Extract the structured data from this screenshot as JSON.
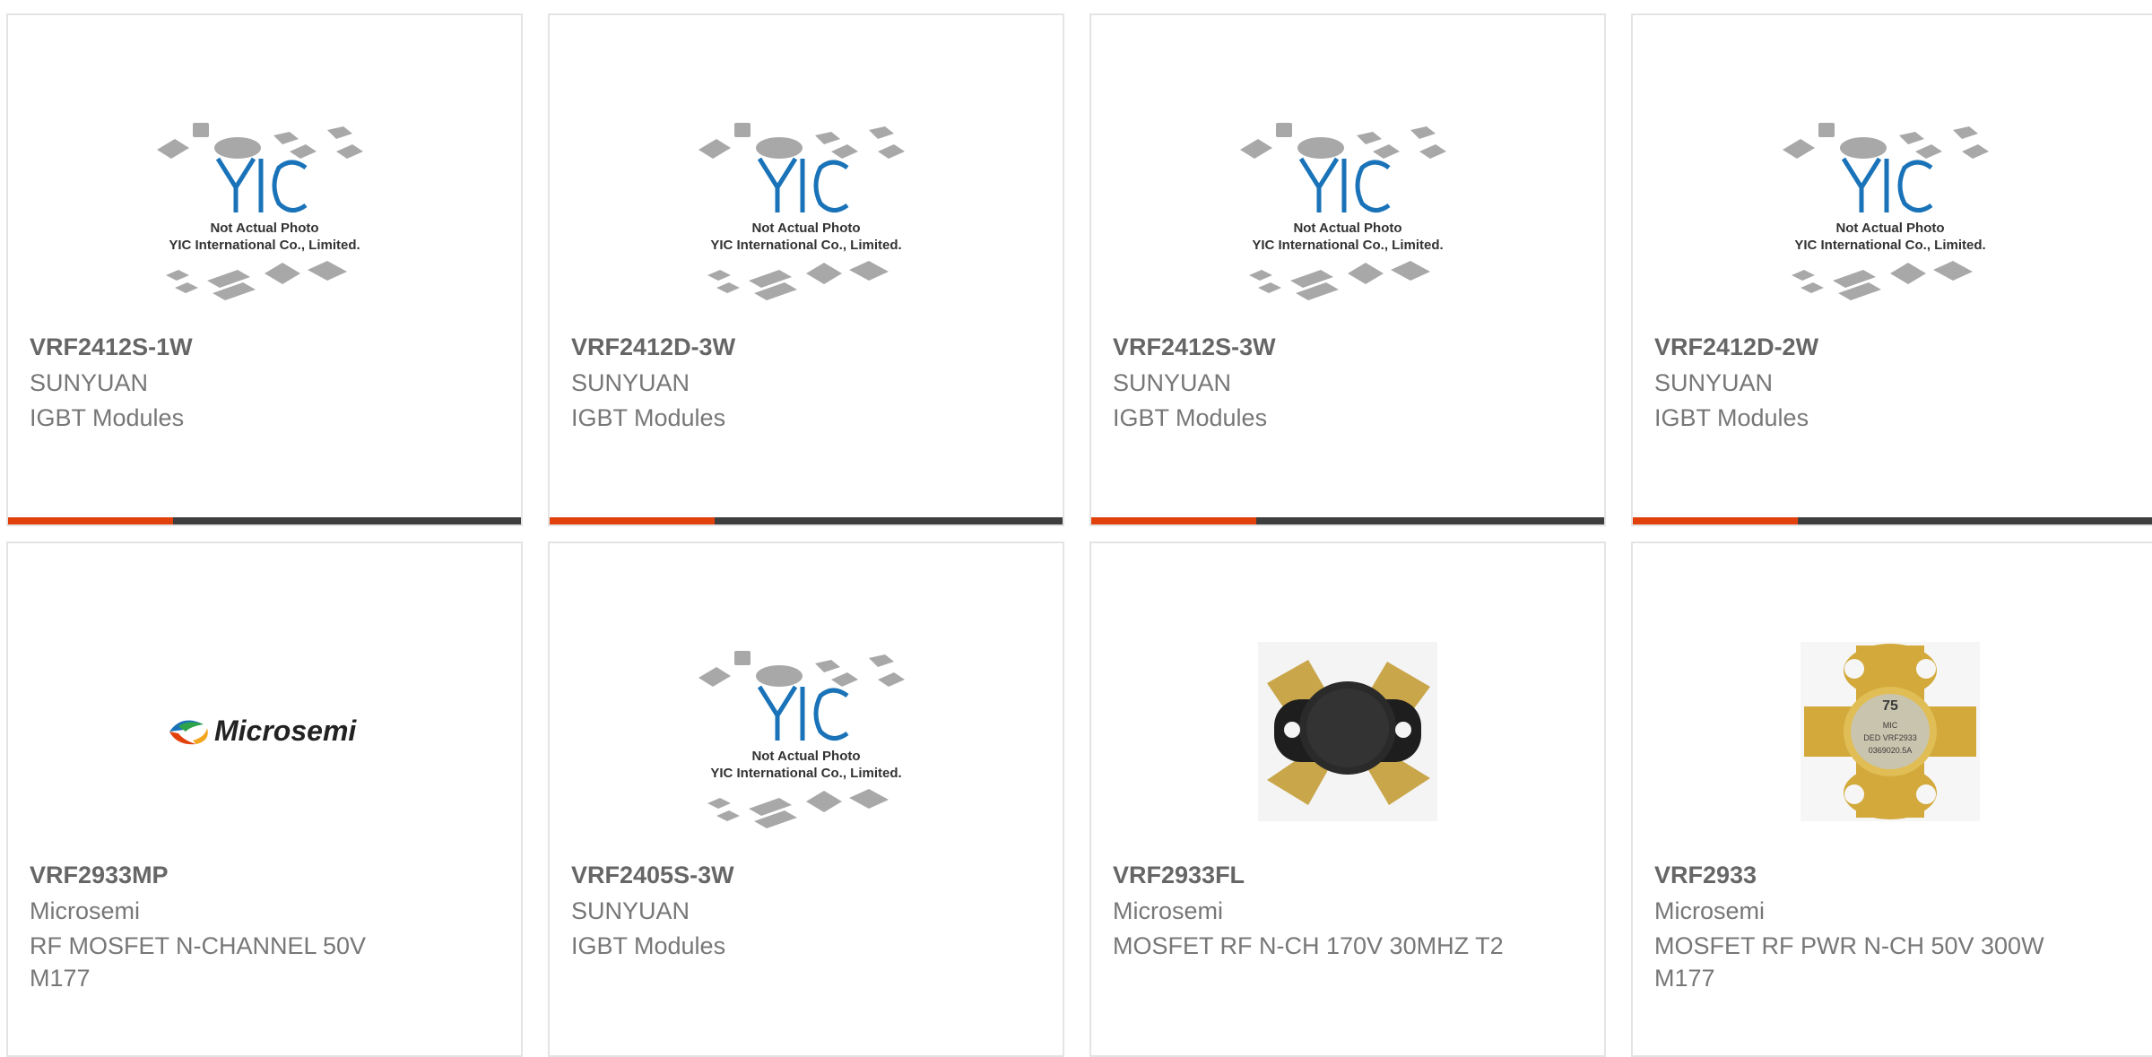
{
  "placeholder": {
    "logo": "YIC",
    "line1": "Not Actual Photo",
    "line2": "YIC International Co., Limited."
  },
  "microsemi_logo_text": "Microsemi",
  "colors": {
    "accent": "#e2410c",
    "bar": "#3e3e3e",
    "yic_blue": "#1a73b8",
    "border": "#e4e4e4"
  },
  "products": [
    {
      "part": "VRF2412S-1W",
      "mfr": "SUNYUAN",
      "desc": "IGBT Modules",
      "image": "yic-placeholder"
    },
    {
      "part": "VRF2412D-3W",
      "mfr": "SUNYUAN",
      "desc": "IGBT Modules",
      "image": "yic-placeholder"
    },
    {
      "part": "VRF2412S-3W",
      "mfr": "SUNYUAN",
      "desc": "IGBT Modules",
      "image": "yic-placeholder"
    },
    {
      "part": "VRF2412D-2W",
      "mfr": "SUNYUAN",
      "desc": "IGBT Modules",
      "image": "yic-placeholder"
    },
    {
      "part": "VRF2933MP",
      "mfr": "Microsemi",
      "desc": "RF MOSFET N-CHANNEL 50V M177",
      "image": "microsemi-logo"
    },
    {
      "part": "VRF2405S-3W",
      "mfr": "SUNYUAN",
      "desc": "IGBT Modules",
      "image": "yic-placeholder"
    },
    {
      "part": "VRF2933FL",
      "mfr": "Microsemi",
      "desc": "MOSFET RF N-CH 170V 30MHZ T2",
      "image": "black-rf-transistor"
    },
    {
      "part": "VRF2933",
      "mfr": "Microsemi",
      "desc": "MOSFET RF PWR N-CH 50V 300W M177",
      "image": "gold-rf-transistor"
    }
  ],
  "gold_chip_marking": {
    "top": "75",
    "line1": "MIC",
    "line2": "DED VRF2933",
    "line3": "0369020.5A"
  }
}
